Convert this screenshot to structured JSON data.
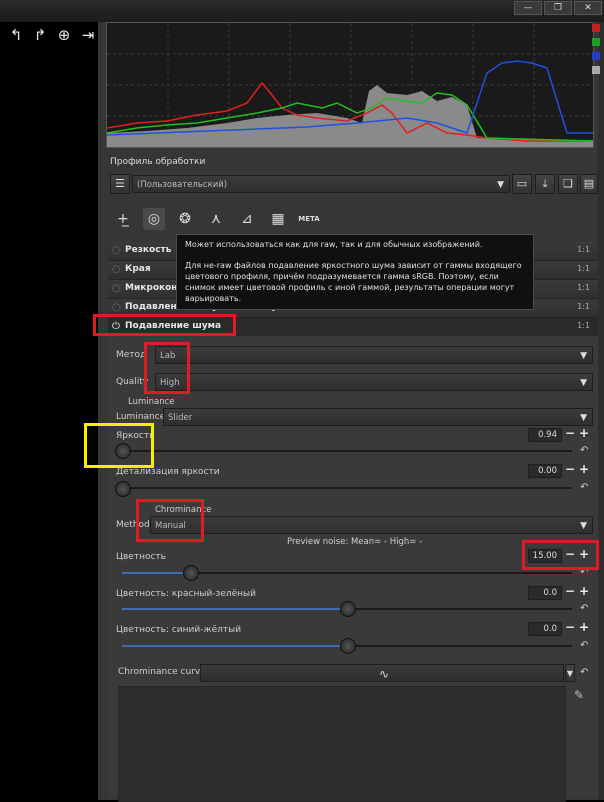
{
  "window": {
    "minimize": "—",
    "restore": "❐",
    "close": "✕"
  },
  "toolbar": {
    "icons": [
      "undo-icon",
      "redo-icon",
      "flip-icon",
      "rotate-icon"
    ],
    "glyphs": [
      "↰",
      "↱",
      "⊕",
      "⇥"
    ]
  },
  "profile": {
    "label": "Профиль обработки",
    "value": "(Пользовательский)",
    "buttons": [
      "open-profile-icon",
      "save-profile-icon",
      "copy-profile-icon",
      "paste-profile-icon"
    ]
  },
  "tabs": [
    {
      "name": "exposure-tab-icon",
      "glyph": "+̲"
    },
    {
      "name": "detail-tab-icon",
      "glyph": "◎"
    },
    {
      "name": "color-tab-icon",
      "glyph": "❂"
    },
    {
      "name": "wavelet-tab-icon",
      "glyph": "⋏"
    },
    {
      "name": "transform-tab-icon",
      "glyph": "⊿"
    },
    {
      "name": "raw-tab-icon",
      "glyph": "▦"
    },
    {
      "name": "metadata-tab-icon",
      "glyph": "META"
    }
  ],
  "sections": {
    "sharpening": "Резкость",
    "edges": "Края",
    "microcontrast": "Микроконт",
    "impulse": "Подавление импульсного шума",
    "noise": "Подавление шума",
    "badge": "1:1"
  },
  "tooltip": {
    "line1": "Может использоваться как для raw, так и для обычных изображений.",
    "line2": "Для не-raw файлов подавление яркостного шума зависит от гаммы входящего цветового профиля, причём подразумевается гамма sRGB. Поэтому, если снимок имеет цветовой профиль с иной гаммой, результаты операции могут варьировать."
  },
  "noise": {
    "method_label": "Метод",
    "method_value": "Lab",
    "quality_label": "Quality",
    "quality_value": "High",
    "luminance_header": "Luminance",
    "lum_control_label": "Luminance control:",
    "lum_control_value": "Slider",
    "brightness_label": "Яркость",
    "brightness_value": "0.94",
    "brightness_level": 0.0,
    "detail_label": "Детализация яркости",
    "detail_value": "0.00",
    "detail_level": 0.0,
    "chroma_header": "Chrominance",
    "chroma_method_label": "Method:",
    "chroma_method_value": "Manual",
    "preview_noise": "Preview noise: Mean= -   High= -",
    "chroma_label": "Цветность",
    "chroma_value": "15.00",
    "chroma_level": 0.15,
    "rg_label": "Цветность: красный-зелёный",
    "rg_value": "0.0",
    "rg_level": 0.5,
    "by_label": "Цветность: синий-жёлтый",
    "by_value": "0.0",
    "by_level": 0.5,
    "curve_label": "Chrominance curve:",
    "plus": "+",
    "minus": "−",
    "reset": "↶"
  },
  "histogram": {
    "channel_colors": [
      "#e02020",
      "#20c020",
      "#2050e0",
      "#cccccc"
    ]
  }
}
